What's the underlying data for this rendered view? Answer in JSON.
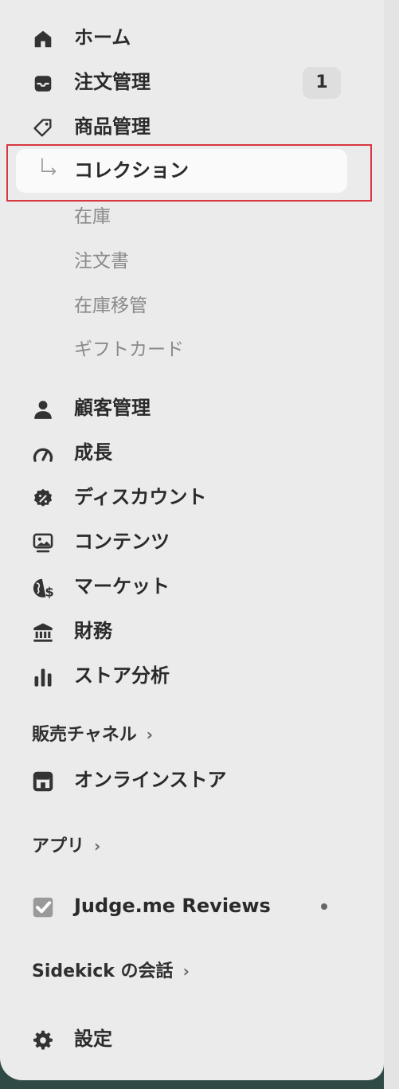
{
  "nav": {
    "home": "ホーム",
    "orders": "注文管理",
    "orders_badge": "1",
    "products": "商品管理",
    "collections": "コレクション",
    "inventory": "在庫",
    "purchase_orders": "注文書",
    "transfers": "在庫移管",
    "gift_cards": "ギフトカード",
    "customers": "顧客管理",
    "marketing": "成長",
    "discounts": "ディスカウント",
    "content": "コンテンツ",
    "markets": "マーケット",
    "finance": "財務",
    "analytics": "ストア分析"
  },
  "sales_channels": {
    "heading": "販売チャネル",
    "chevron": "›",
    "online_store": "オンラインストア"
  },
  "apps": {
    "heading": "アプリ",
    "chevron": "›",
    "app_name": "Judge.me Reviews"
  },
  "sidekick": {
    "heading": "Sidekick の会話",
    "chevron": "›"
  },
  "settings": {
    "label": "設定"
  },
  "colors": {
    "panel_bg": "#ebebeb",
    "selected_bg": "#fafafa",
    "highlight_border": "#d7373f",
    "text_primary": "#2a2a2a",
    "text_secondary": "#8a8a8a"
  }
}
